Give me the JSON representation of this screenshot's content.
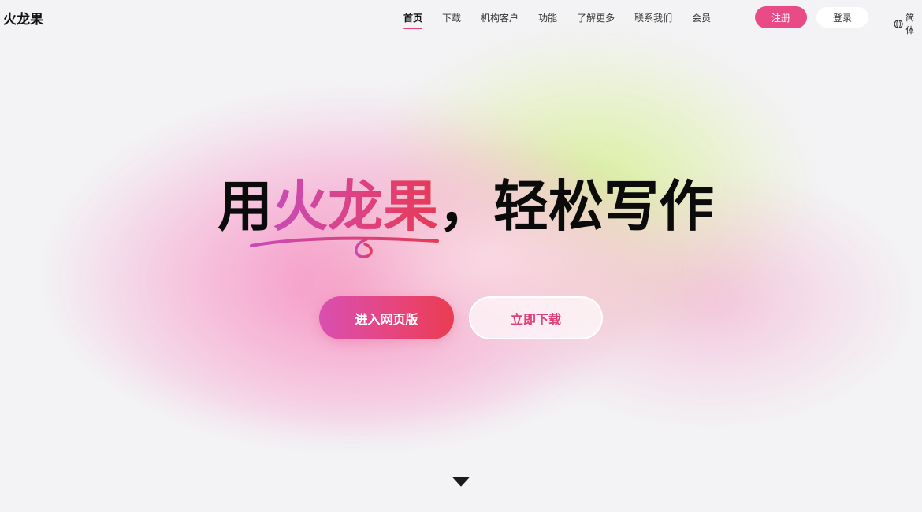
{
  "header": {
    "logo_text": "火龙果",
    "nav": [
      {
        "label": "首页",
        "active": true
      },
      {
        "label": "下载"
      },
      {
        "label": "机构客户"
      },
      {
        "label": "功能"
      },
      {
        "label": "了解更多"
      },
      {
        "label": "联系我们"
      },
      {
        "label": "会员"
      }
    ],
    "register_label": "注册",
    "login_label": "登录",
    "language_label": "简体"
  },
  "hero": {
    "title_prefix": "用",
    "title_highlight": "火龙果",
    "title_suffix": "，轻松写作",
    "primary_button": "进入网页版",
    "secondary_button": "立即下载"
  },
  "colors": {
    "accent": "#e94b86",
    "gradient_start": "#d94fb0",
    "gradient_end": "#ea3c52",
    "background": "#f3f3f5"
  },
  "icons": {
    "language": "globe-icon",
    "scroll": "triangle-down-icon"
  }
}
